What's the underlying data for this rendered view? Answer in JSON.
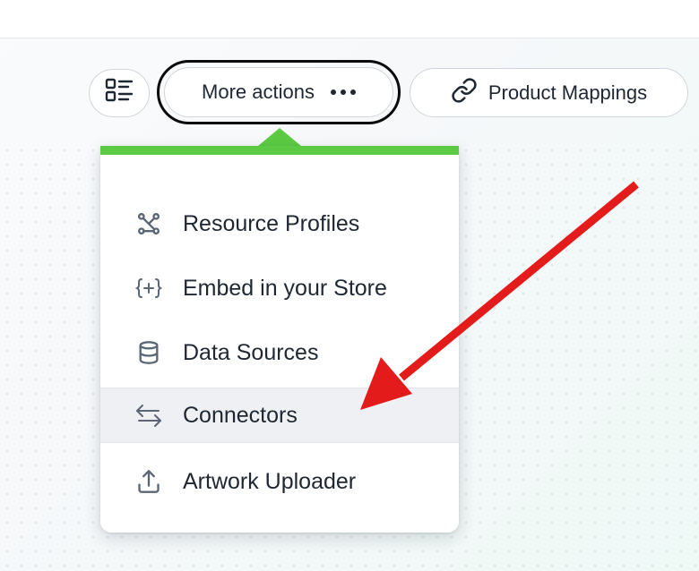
{
  "toolbar": {
    "more_actions_label": "More actions",
    "product_mappings_label": "Product Mappings",
    "view_toggle_icon": "list-view-icon",
    "more_icon": "ellipsis-icon",
    "mappings_icon": "link-icon"
  },
  "menu": {
    "accent_color": "#5ccb43",
    "items": [
      {
        "label": "Resource Profiles",
        "icon": "graph-nodes-icon"
      },
      {
        "label": "Embed in your Store",
        "icon": "embed-code-icon"
      },
      {
        "label": "Data Sources",
        "icon": "database-icon"
      },
      {
        "label": "Connectors",
        "icon": "swap-arrows-icon",
        "highlighted": true
      },
      {
        "label": "Artwork Uploader",
        "icon": "upload-icon"
      }
    ]
  },
  "annotation": {
    "arrow_color": "#e31b1b",
    "points_to": "Connectors"
  }
}
